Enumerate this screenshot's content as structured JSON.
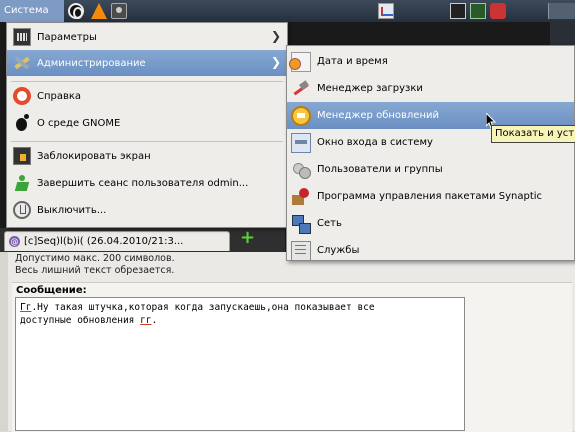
{
  "panel": {
    "system_menu_label": "Система",
    "launchers": [
      "opera-icon",
      "vlc-icon",
      "screenshot-icon"
    ],
    "tray": [
      "system-monitor-icon",
      "terminal-icon",
      "network-monitor-icon",
      "network-icon",
      "workspace-switcher"
    ]
  },
  "system_menu": {
    "items": [
      {
        "label": "Параметры",
        "icon": "preferences-icon",
        "has_submenu": true
      },
      {
        "label": "Администрирование",
        "icon": "administration-icon",
        "has_submenu": true,
        "selected": true
      },
      {
        "label": "Справка",
        "icon": "help-icon"
      },
      {
        "label": "О среде GNOME",
        "icon": "gnome-foot-icon"
      },
      {
        "label": "Заблокировать экран",
        "icon": "lock-screen-icon"
      },
      {
        "label": "Завершить сеанс пользователя odmin...",
        "icon": "logout-icon"
      },
      {
        "label": "Выключить...",
        "icon": "power-icon"
      }
    ]
  },
  "admin_submenu": {
    "items": [
      {
        "label": "Дата и время",
        "icon": "clock-icon"
      },
      {
        "label": "Менеджер загрузки",
        "icon": "boot-manager-icon"
      },
      {
        "label": "Менеджер обновлений",
        "icon": "update-manager-icon",
        "selected": true
      },
      {
        "label": "Окно входа в систему",
        "icon": "login-window-icon"
      },
      {
        "label": "Пользователи и группы",
        "icon": "users-groups-icon"
      },
      {
        "label": "Программа управления пакетами Synaptic",
        "icon": "synaptic-icon"
      },
      {
        "label": "Сеть",
        "icon": "network-icon"
      },
      {
        "label": "Службы",
        "icon": "services-icon"
      }
    ]
  },
  "tooltip": "Показать и уст",
  "browser": {
    "tab_title": "[c]Seq)l(b)i( (26.04.2010/21:3...",
    "new_tab_label": "+"
  },
  "form": {
    "hint_line1": "Допустимо макс. 200 символов.",
    "hint_line2": "Весь лишний текст обрезается.",
    "message_label": "Сообщение:",
    "message_gr1": "Гг",
    "message_line1_rest": ".Ну такая штучка,которая когда запускаешь,она показывает все",
    "message_line2_start": "доступные обновления ",
    "message_gr2": "гг",
    "message_line2_end": "."
  },
  "colors": {
    "selection": "#6a8fc2",
    "panel": "#2f3b4a",
    "tooltip_bg": "#f8f4b8"
  }
}
